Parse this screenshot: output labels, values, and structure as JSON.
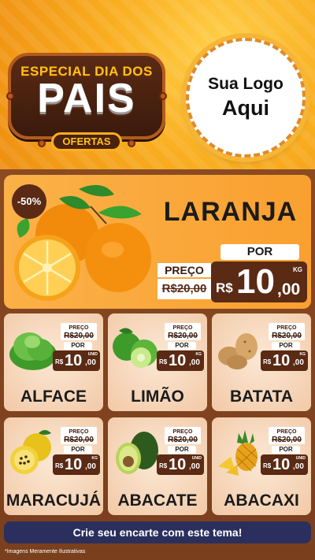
{
  "header": {
    "badge_top": "ESPECIAL DIA DOS",
    "badge_main": "PAIS",
    "badge_ribbon": "OFERTAS",
    "logo_line1": "Sua Logo",
    "logo_line2": "Aqui"
  },
  "featured": {
    "discount": "-50%",
    "name": "LARANJA",
    "preco_label": "PREÇO",
    "old_price": "R$20,00",
    "por_label": "POR",
    "currency": "R$",
    "price_int": "10",
    "price_dec": ",00",
    "unit": "KG",
    "icon": "orange-icon"
  },
  "products": [
    {
      "name": "ALFACE",
      "preco_label": "PREÇO",
      "old_price": "R$20,00",
      "por_label": "POR",
      "currency": "R$",
      "price_int": "10",
      "price_dec": ",00",
      "unit": "UNID",
      "icon": "lettuce-icon"
    },
    {
      "name": "LIMÃO",
      "preco_label": "PREÇO",
      "old_price": "R$20,00",
      "por_label": "POR",
      "currency": "R$",
      "price_int": "10",
      "price_dec": ",00",
      "unit": "KG",
      "icon": "lime-icon"
    },
    {
      "name": "BATATA",
      "preco_label": "PREÇO",
      "old_price": "R$20,00",
      "por_label": "POR",
      "currency": "R$",
      "price_int": "10",
      "price_dec": ",00",
      "unit": "KG",
      "icon": "potato-icon"
    },
    {
      "name": "MARACUJÁ",
      "preco_label": "PREÇO",
      "old_price": "R$20,00",
      "por_label": "POR",
      "currency": "R$",
      "price_int": "10",
      "price_dec": ",00",
      "unit": "KG",
      "icon": "passion-fruit-icon"
    },
    {
      "name": "ABACATE",
      "preco_label": "PREÇO",
      "old_price": "R$20,00",
      "por_label": "POR",
      "currency": "R$",
      "price_int": "10",
      "price_dec": ",00",
      "unit": "UNID",
      "icon": "avocado-icon"
    },
    {
      "name": "ABACAXI",
      "preco_label": "PREÇO",
      "old_price": "R$20,00",
      "por_label": "POR",
      "currency": "R$",
      "price_int": "10",
      "price_dec": ",00",
      "unit": "UNID",
      "icon": "pineapple-icon"
    }
  ],
  "banner": "Crie seu encarte com este tema!",
  "disclaimer": "*Imagens Meramente Ilustrativas",
  "colors": {
    "accent": "#f9a030",
    "brown": "#5a2a14",
    "banner": "#2b2f5e"
  }
}
